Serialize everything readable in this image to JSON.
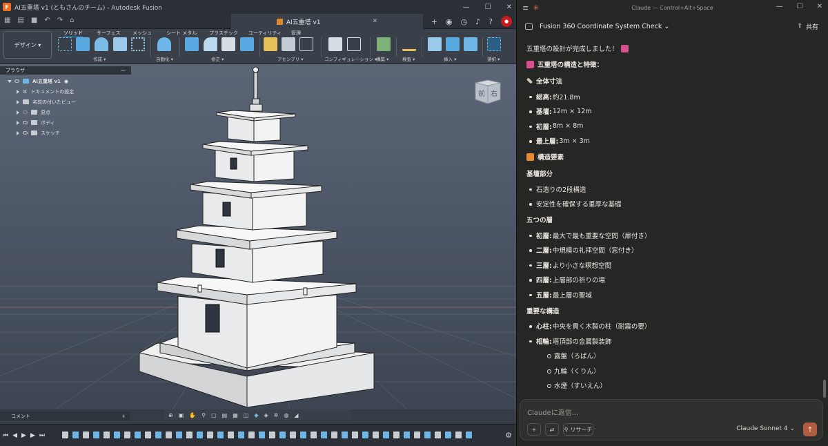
{
  "fusion": {
    "window_title": "AI五重塔 v1 (ともさんのチーム) - Autodesk Fusion",
    "doc_tab": "AI五重塔 v1",
    "workspace_button": "デザイン ▾",
    "ribbon_tabs": [
      "ソリッド",
      "サーフェス",
      "メッシュ",
      "シート メタル",
      "プラスチック",
      "ユーティリティ",
      "管理"
    ],
    "ribbon_groups": [
      "作成 ▾",
      "自動化 ▾",
      "修正 ▾",
      "アセンブリ ▾",
      "コンフィギュレーション ▾",
      "構築 ▾",
      "検査 ▾",
      "挿入 ▾",
      "選択 ▾"
    ],
    "browser": {
      "title": "ブラウザ",
      "root": "AI五重塔 v1",
      "items": [
        "ドキュメントの設定",
        "名前の付いたビュー",
        "原点",
        "ボディ",
        "スケッチ"
      ]
    },
    "viewcube": {
      "front": "前",
      "right": "右"
    },
    "comment_panel": "コメント",
    "colors": {
      "accent": "#2d9cdb",
      "orange": "#f26b21",
      "viewport": "#4d5666"
    }
  },
  "claude": {
    "window_title": "Claude — Control+Alt+Space",
    "conversation_title": "Fusion 360 Coordinate System Check ⌄",
    "share_label": "共有",
    "intro": "五重塔の設計が完成しました！",
    "section1": "五重塔の構造と特徴：",
    "dims_heading": "全体寸法",
    "dims": [
      {
        "label": "総高:",
        "value": " 約21.8m"
      },
      {
        "label": "基壇:",
        "value": " 12m × 12m"
      },
      {
        "label": "初層:",
        "value": " 8m × 8m"
      },
      {
        "label": "最上層:",
        "value": " 3m × 3m"
      }
    ],
    "struct_heading": "構造要素",
    "base_heading": "基壇部分",
    "base_items": [
      "石造りの2段構造",
      "安定性を確保する重厚な基礎"
    ],
    "floors_heading": "五つの層",
    "floors": [
      {
        "label": "初層:",
        "value": " 最大で最も重要な空間（扉付き）"
      },
      {
        "label": "二層:",
        "value": " 中規模の礼拝空間（窓付き）"
      },
      {
        "label": "三層:",
        "value": " より小さな瞑想空間"
      },
      {
        "label": "四層:",
        "value": " 上層部の祈りの場"
      },
      {
        "label": "五層:",
        "value": " 最上層の聖域"
      }
    ],
    "important_heading": "重要な構造",
    "important": [
      {
        "label": "心柱:",
        "value": " 中央を貫く木製の柱（耐震の要）"
      },
      {
        "label": "相輪:",
        "value": " 塔頂部の金属製装飾"
      }
    ],
    "sorin_parts": [
      "露盤（ろばん）",
      "九輪（くりん）",
      "水煙（すいえん）"
    ],
    "composer_placeholder": "Claudeに返信...",
    "research_label": "リサーチ",
    "model_label": "Claude Sonnet 4 ⌄",
    "colors": {
      "accent": "#d97757",
      "bg": "#262624"
    }
  }
}
